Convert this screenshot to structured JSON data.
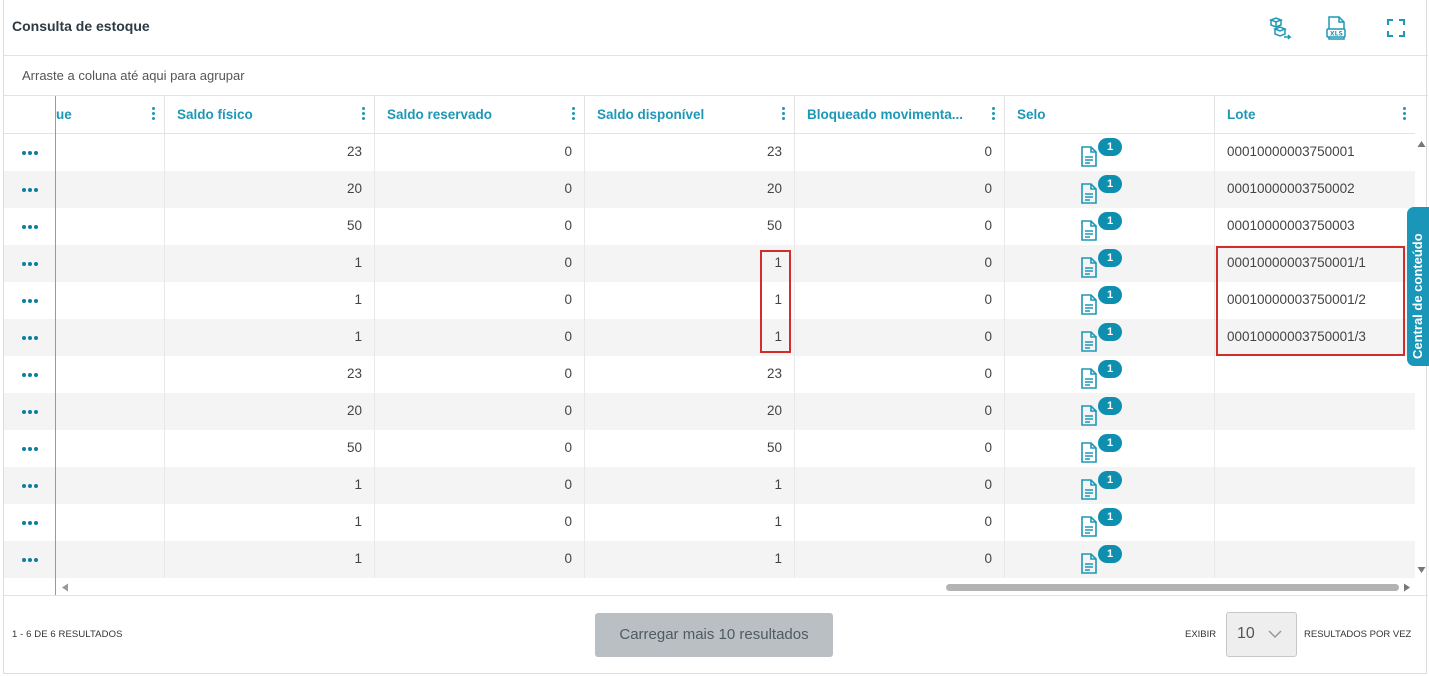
{
  "header": {
    "title": "Consulta de estoque"
  },
  "icons": {
    "stock": "boxes-transfer-icon",
    "xls": "xls-export-icon",
    "fullscreen": "fullscreen-icon"
  },
  "group_bar": {
    "text": "Arraste a coluna até aqui para agrupar"
  },
  "columns": [
    {
      "label": "ue"
    },
    {
      "label": "Saldo físico"
    },
    {
      "label": "Saldo reservado"
    },
    {
      "label": "Saldo disponível"
    },
    {
      "label": "Bloqueado movimenta..."
    },
    {
      "label": "Selo"
    },
    {
      "label": "Lote"
    }
  ],
  "rows": [
    {
      "fisico": "23",
      "reservado": "0",
      "disponivel": "23",
      "bloqueado": "0",
      "selo": "1",
      "lote": "00010000003750001"
    },
    {
      "fisico": "20",
      "reservado": "0",
      "disponivel": "20",
      "bloqueado": "0",
      "selo": "1",
      "lote": "00010000003750002"
    },
    {
      "fisico": "50",
      "reservado": "0",
      "disponivel": "50",
      "bloqueado": "0",
      "selo": "1",
      "lote": "00010000003750003"
    },
    {
      "fisico": "1",
      "reservado": "0",
      "disponivel": "1",
      "bloqueado": "0",
      "selo": "1",
      "lote": "00010000003750001/1"
    },
    {
      "fisico": "1",
      "reservado": "0",
      "disponivel": "1",
      "bloqueado": "0",
      "selo": "1",
      "lote": "00010000003750001/2"
    },
    {
      "fisico": "1",
      "reservado": "0",
      "disponivel": "1",
      "bloqueado": "0",
      "selo": "1",
      "lote": "00010000003750001/3"
    },
    {
      "fisico": "23",
      "reservado": "0",
      "disponivel": "23",
      "bloqueado": "0",
      "selo": "1",
      "lote": ""
    },
    {
      "fisico": "20",
      "reservado": "0",
      "disponivel": "20",
      "bloqueado": "0",
      "selo": "1",
      "lote": ""
    },
    {
      "fisico": "50",
      "reservado": "0",
      "disponivel": "50",
      "bloqueado": "0",
      "selo": "1",
      "lote": ""
    },
    {
      "fisico": "1",
      "reservado": "0",
      "disponivel": "1",
      "bloqueado": "0",
      "selo": "1",
      "lote": ""
    },
    {
      "fisico": "1",
      "reservado": "0",
      "disponivel": "1",
      "bloqueado": "0",
      "selo": "1",
      "lote": ""
    },
    {
      "fisico": "1",
      "reservado": "0",
      "disponivel": "1",
      "bloqueado": "0",
      "selo": "1",
      "lote": ""
    }
  ],
  "footer": {
    "count": "1 - 6 DE 6 RESULTADOS",
    "load_more": "Carregar mais 10 resultados",
    "exibir": "EXIBIR",
    "page_size": "10",
    "per_page": "RESULTADOS POR VEZ"
  },
  "side_tab": {
    "label": "Central de conteúdo"
  },
  "colors": {
    "accent": "#1d98b6",
    "highlight": "#d12d2d",
    "button_disabled": "#b9bfc2"
  }
}
